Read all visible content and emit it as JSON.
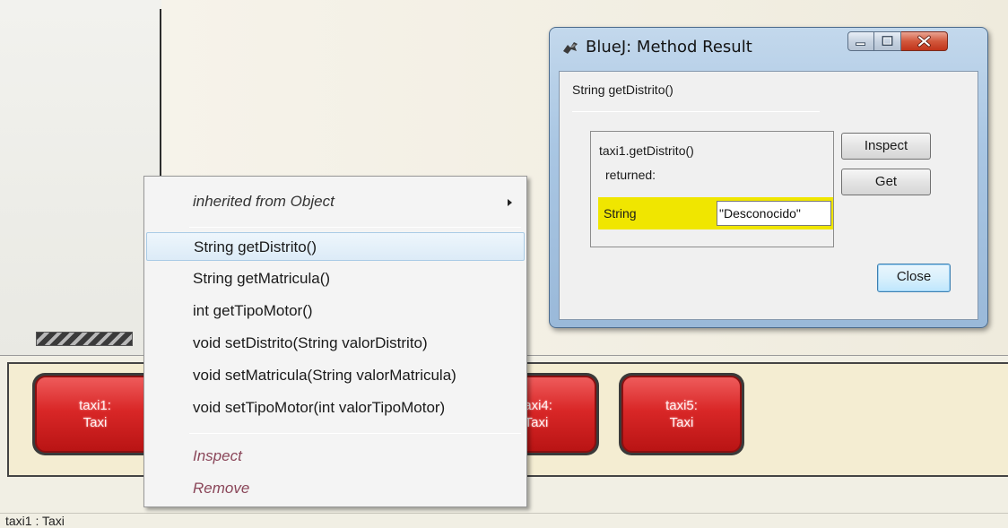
{
  "status_bar": {
    "text": "taxi1 : Taxi"
  },
  "object_bench": {
    "objects": [
      {
        "name": "taxi1:",
        "type": "Taxi"
      },
      {
        "name": "taxi4:",
        "type": "Taxi"
      },
      {
        "name": "taxi5:",
        "type": "Taxi"
      }
    ]
  },
  "context_menu": {
    "inherited": "inherited from Object",
    "methods": [
      "String getDistrito()",
      "String getMatricula()",
      "int getTipoMotor()",
      "void setDistrito(String valorDistrito)",
      "void setMatricula(String valorMatricula)",
      "void setTipoMotor(int valorTipoMotor)"
    ],
    "inspect": "Inspect",
    "remove": "Remove"
  },
  "dialog": {
    "title": "BlueJ:  Method Result",
    "signature": "String getDistrito()",
    "call": "taxi1.getDistrito()",
    "returned": "returned:",
    "result_type": "String",
    "result_value": "\"Desconocido\"",
    "buttons": {
      "inspect": "Inspect",
      "get": "Get",
      "close": "Close"
    }
  },
  "colors": {
    "object_red": "#d92727",
    "highlight_yellow": "#f0e600",
    "menu_hover": "#dcebf7"
  }
}
